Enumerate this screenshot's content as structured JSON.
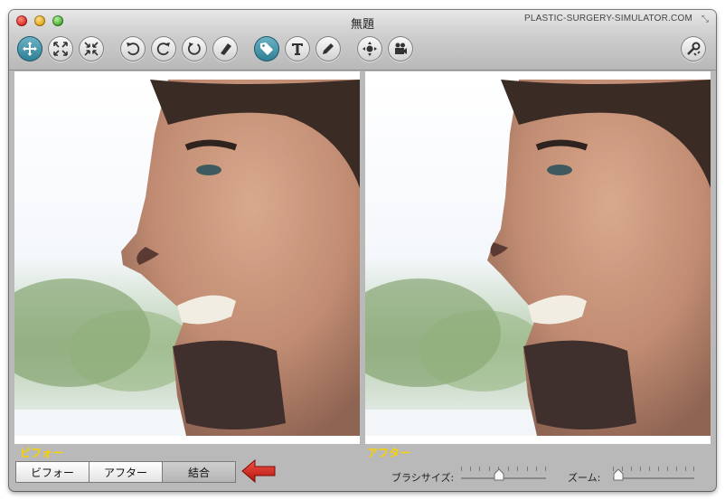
{
  "window": {
    "title": "無題",
    "brand": "PLASTIC-SURGERY-SIMULATOR.COM"
  },
  "toolbar": {
    "buttons": [
      {
        "icon": "move-icon",
        "active": true
      },
      {
        "icon": "expand-icon",
        "active": false
      },
      {
        "icon": "shrink-icon",
        "active": false
      },
      {
        "icon": "undo-icon",
        "active": false
      },
      {
        "icon": "redo-icon",
        "active": false
      },
      {
        "icon": "reset-icon",
        "active": false
      },
      {
        "icon": "eraser-icon",
        "active": false
      },
      {
        "icon": "tag-icon",
        "active": true
      },
      {
        "icon": "text-icon",
        "active": false
      },
      {
        "icon": "pencil-icon",
        "active": false
      },
      {
        "icon": "navigate-icon",
        "active": false
      },
      {
        "icon": "camera-icon",
        "active": false
      },
      {
        "icon": "settings-icon",
        "active": false
      }
    ]
  },
  "panels": {
    "before_label": "ビフォー",
    "after_label": "アフター"
  },
  "view_mode": {
    "options": [
      "ビフォー",
      "アフター",
      "結合"
    ],
    "selected": "結合"
  },
  "brush_size": {
    "label": "ブラシサイズ:",
    "value": 0.45
  },
  "zoom": {
    "label": "ズーム:",
    "value": 0.0
  },
  "colors": {
    "accent": "#2d7d92",
    "label_yellow": "#f7d200",
    "arrow_red": "#d31a10"
  }
}
